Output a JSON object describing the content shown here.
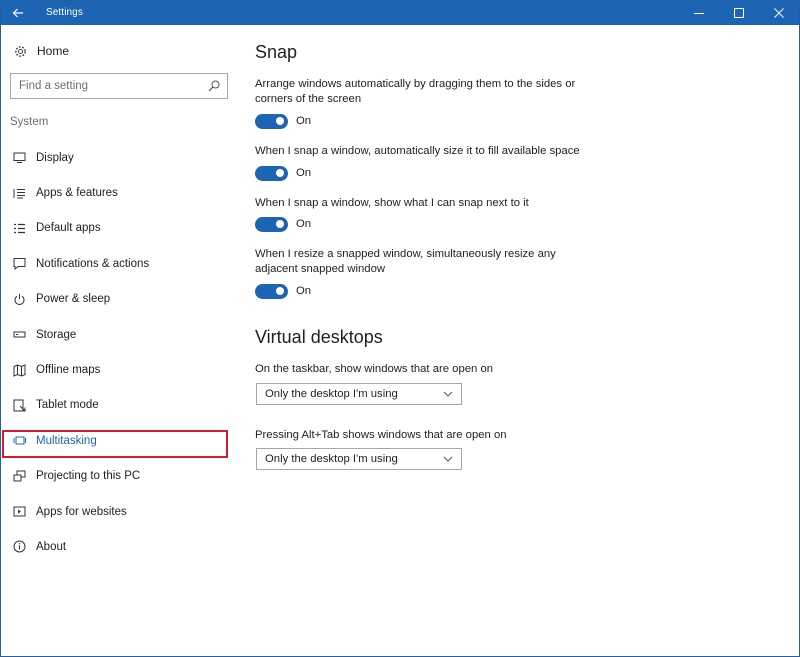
{
  "window": {
    "title": "Settings"
  },
  "sidebar": {
    "home_label": "Home",
    "search_placeholder": "Find a setting",
    "section_label": "System",
    "items": [
      {
        "label": "Display",
        "icon": "monitor-icon"
      },
      {
        "label": "Apps & features",
        "icon": "list-icon"
      },
      {
        "label": "Default apps",
        "icon": "default-apps-icon"
      },
      {
        "label": "Notifications & actions",
        "icon": "notification-icon"
      },
      {
        "label": "Power & sleep",
        "icon": "power-icon"
      },
      {
        "label": "Storage",
        "icon": "storage-icon"
      },
      {
        "label": "Offline maps",
        "icon": "map-icon"
      },
      {
        "label": "Tablet mode",
        "icon": "tablet-icon"
      },
      {
        "label": "Multitasking",
        "icon": "multitasking-icon",
        "active": true
      },
      {
        "label": "Projecting to this PC",
        "icon": "projecting-icon"
      },
      {
        "label": "Apps for websites",
        "icon": "apps-websites-icon"
      },
      {
        "label": "About",
        "icon": "info-icon"
      }
    ]
  },
  "snap": {
    "heading": "Snap",
    "settings": [
      {
        "description": "Arrange windows automatically by dragging them to the sides or corners of the screen",
        "state": "On"
      },
      {
        "description": "When I snap a window, automatically size it to fill available space",
        "state": "On"
      },
      {
        "description": "When I snap a window, show what I can snap next to it",
        "state": "On"
      },
      {
        "description": "When I resize a snapped window, simultaneously resize any adjacent snapped window",
        "state": "On"
      }
    ]
  },
  "virtual_desktops": {
    "heading": "Virtual desktops",
    "taskbar": {
      "label": "On the taskbar, show windows that are open on",
      "value": "Only the desktop I'm using"
    },
    "alttab": {
      "label": "Pressing Alt+Tab shows windows that are open on",
      "value": "Only the desktop I'm using"
    }
  },
  "colors": {
    "accent": "#1e64b4",
    "highlight_box": "#d41d2b"
  }
}
